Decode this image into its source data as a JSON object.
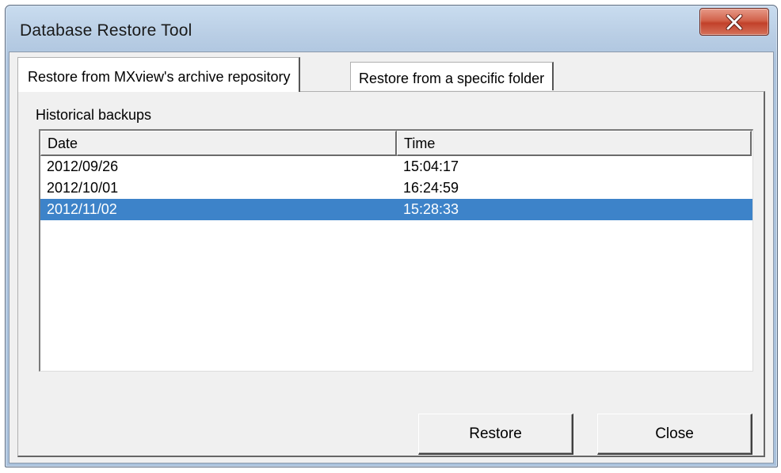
{
  "window": {
    "title": "Database Restore Tool"
  },
  "tabs": [
    {
      "label": "Restore from MXview's archive repository",
      "active": true
    },
    {
      "label": "Restore from a specific folder",
      "active": false
    }
  ],
  "backups": {
    "section_label": "Historical backups",
    "columns": [
      "Date",
      "Time"
    ],
    "rows": [
      {
        "date": "2012/09/26",
        "time": "15:04:17",
        "selected": false
      },
      {
        "date": "2012/10/01",
        "time": "16:24:59",
        "selected": false
      },
      {
        "date": "2012/11/02",
        "time": "15:28:33",
        "selected": true
      }
    ]
  },
  "buttons": {
    "restore_label": "Restore",
    "close_label": "Close"
  },
  "colors": {
    "selection": "#3d83c9",
    "titlebar": "#b8cde4",
    "close_button": "#c2412a"
  },
  "icons": {
    "close": "close-x-icon"
  }
}
